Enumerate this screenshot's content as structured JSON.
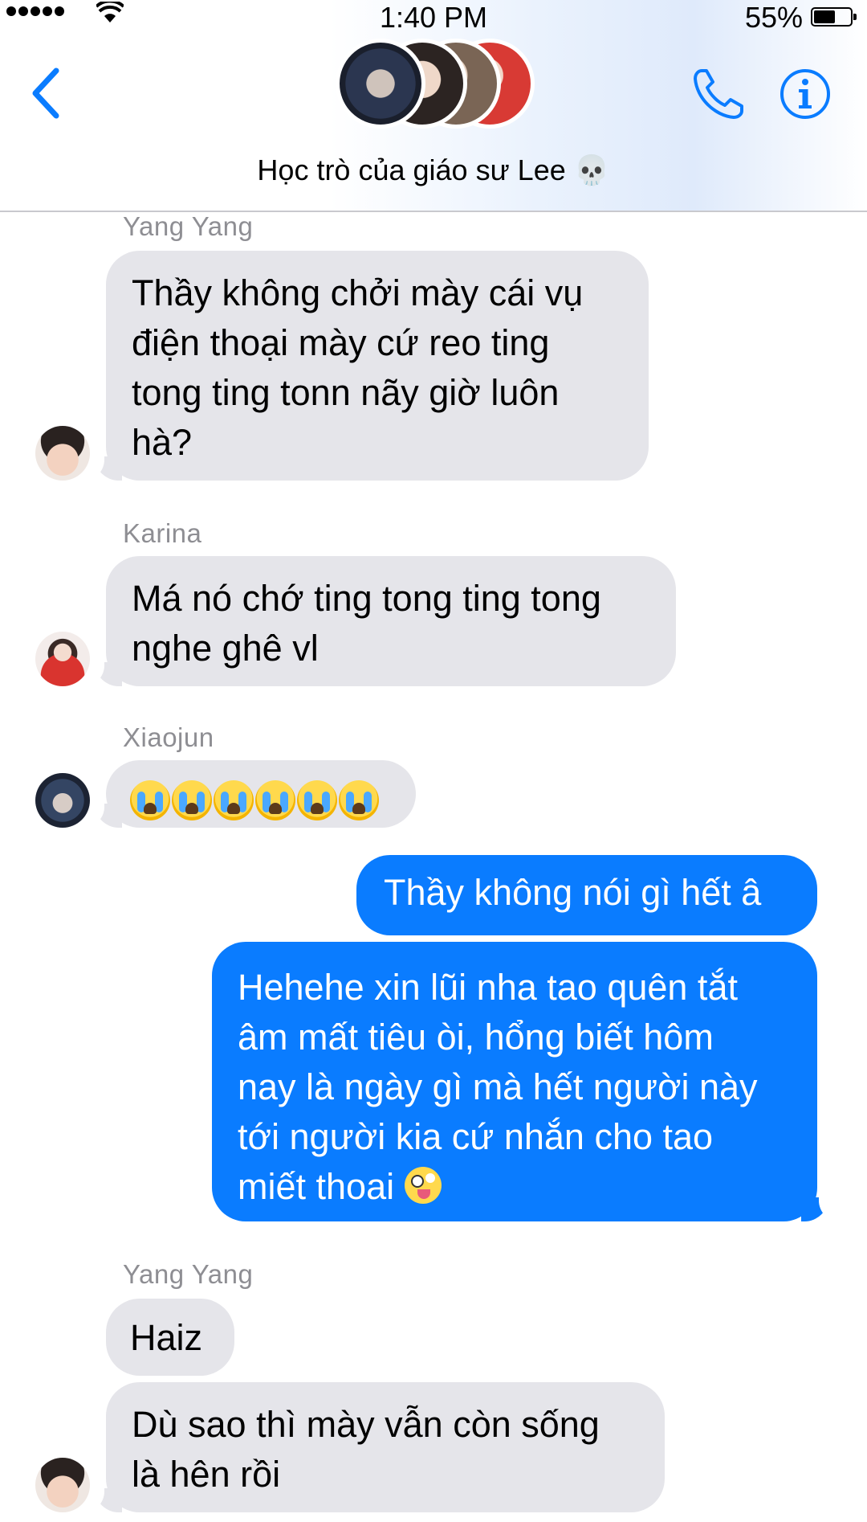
{
  "status_bar": {
    "time": "1:40 PM",
    "battery_percent": "55%",
    "battery_level": 0.55,
    "signal_bars": 5,
    "icons": [
      "signal-dots-icon",
      "wifi-icon",
      "battery-icon"
    ]
  },
  "header": {
    "title": "Học trò của giáo sư Lee",
    "title_emoji": "💀",
    "accent_color": "#0a7cff",
    "icons": [
      "back-chevron-icon",
      "phone-icon",
      "info-icon"
    ],
    "group_avatar_count": 4
  },
  "messages": [
    {
      "sender": "Yang Yang",
      "direction": "incoming",
      "avatar": "avatar-yang-yang",
      "lines": [
        "Thầy không chởi mày cái vụ",
        "điện thoại mày cứ reo ting",
        "tong ting tonn nãy giờ luôn",
        "hà?"
      ]
    },
    {
      "sender": "Karina",
      "direction": "incoming",
      "avatar": "avatar-karina",
      "lines": [
        "Má nó chớ ting tong ting tong",
        "nghe ghê vl"
      ]
    },
    {
      "sender": "Xiaojun",
      "direction": "incoming",
      "avatar": "avatar-xiaojun",
      "text": "😭😭😭😭😭😭",
      "emoji_count": 6
    },
    {
      "direction": "outgoing",
      "lines": [
        "Thầy không nói gì hết â"
      ]
    },
    {
      "direction": "outgoing",
      "lines": [
        "Hehehe xin lũi nha tao quên tắt",
        "âm mất tiêu òi, hổng biết hôm",
        "nay là ngày gì mà hết người này",
        "tới người kia cứ nhắn cho tao",
        "miết thoai"
      ],
      "trailing_emoji": "🤪"
    },
    {
      "sender": "Yang Yang",
      "direction": "incoming",
      "lines": [
        "Haiz"
      ]
    },
    {
      "direction": "incoming",
      "avatar": "avatar-yang-yang",
      "lines": [
        "Dù sao thì mày vẫn còn sống",
        "là hên rồi"
      ]
    }
  ],
  "colors": {
    "incoming_bubble": "#e5e5ea",
    "outgoing_bubble": "#0a7cff",
    "sender_name": "#8e8e93"
  }
}
